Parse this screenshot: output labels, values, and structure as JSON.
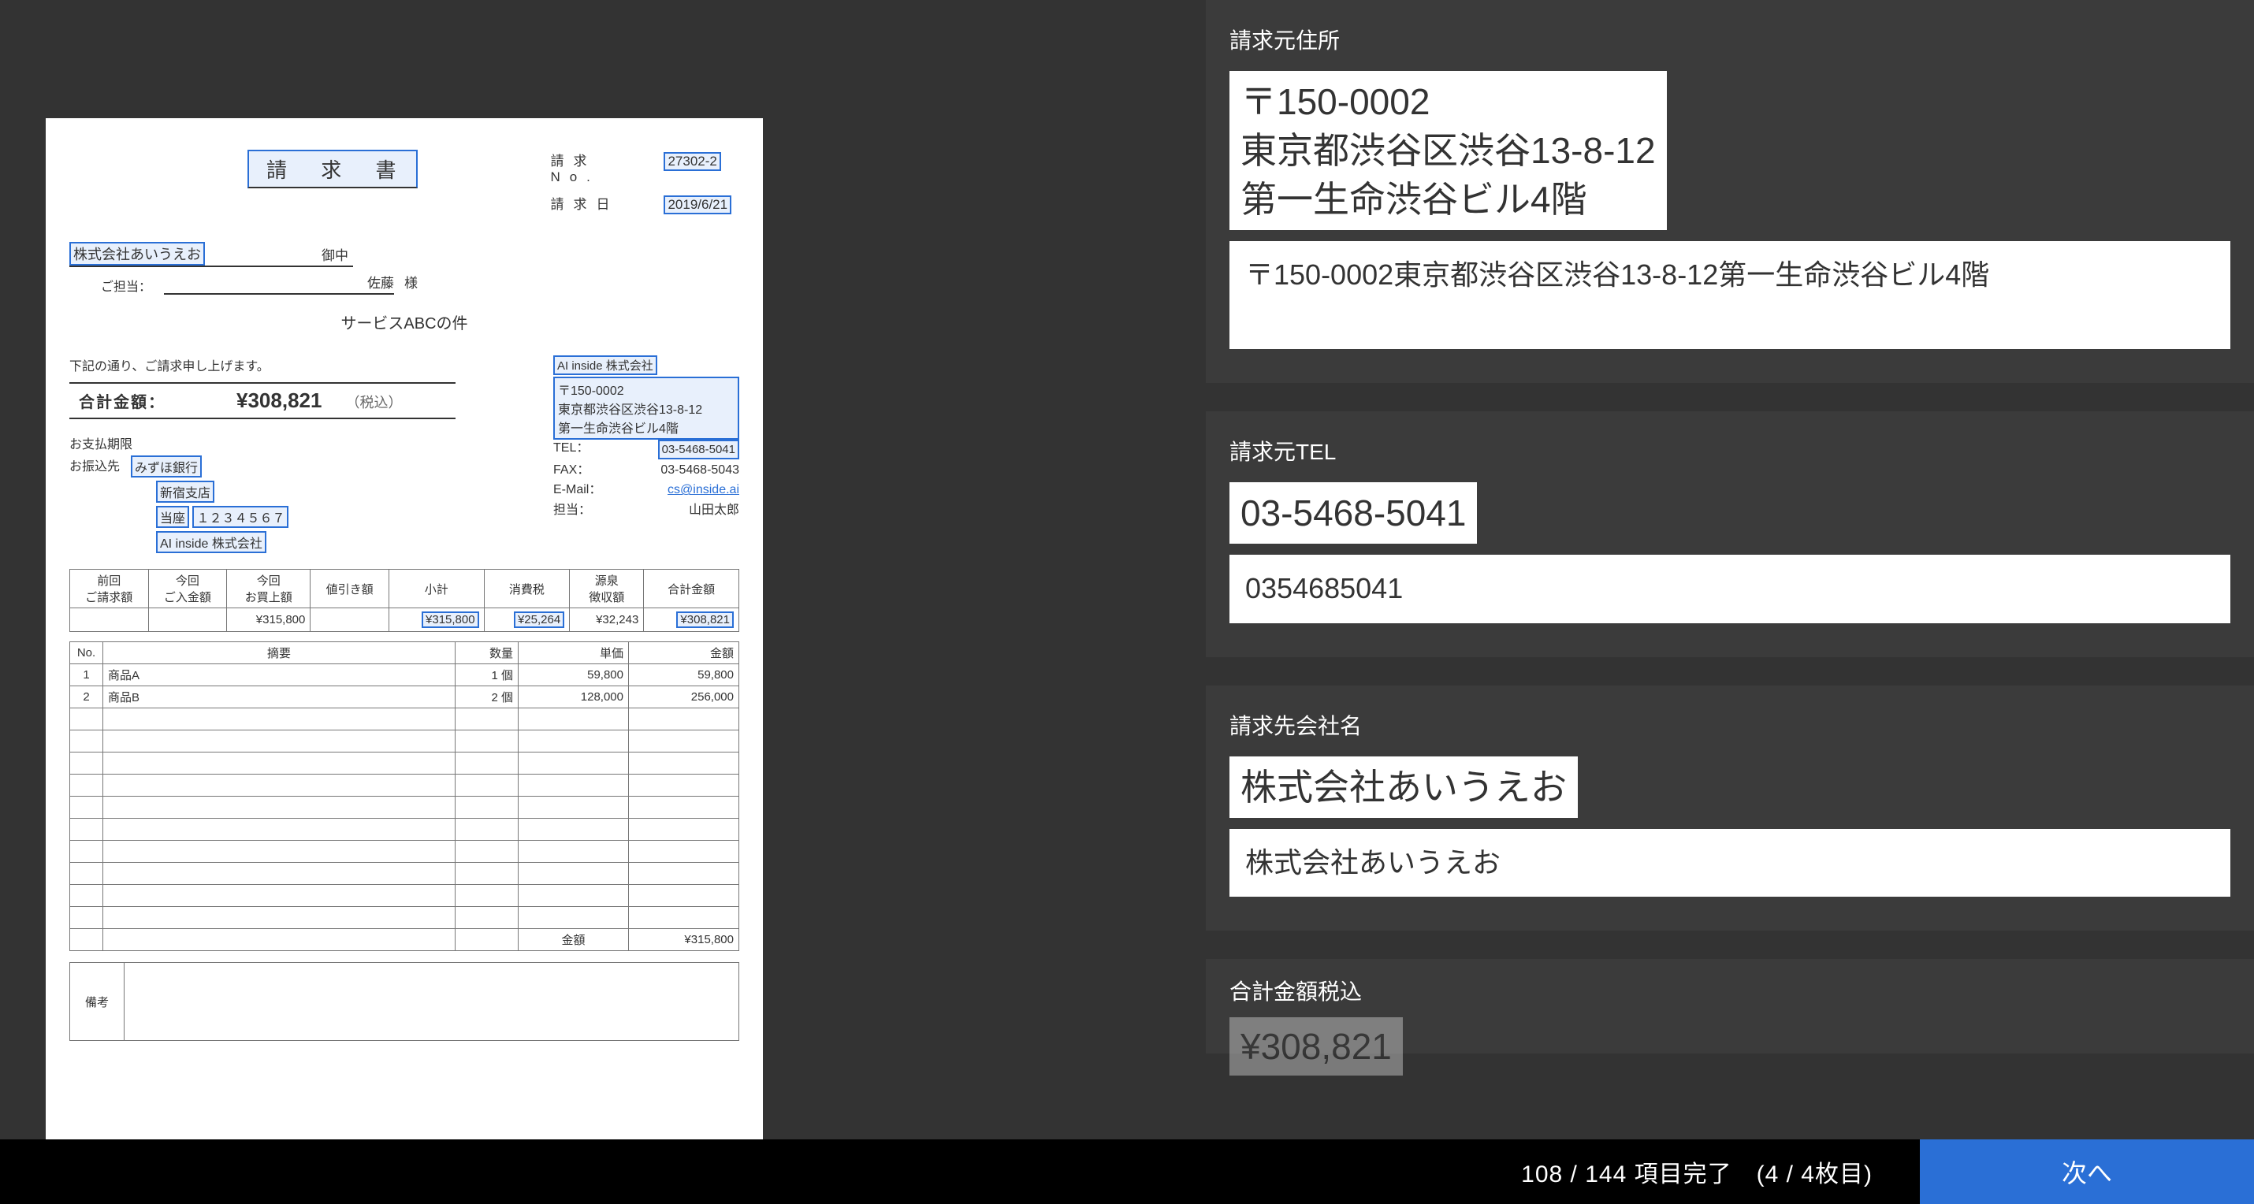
{
  "document": {
    "title": "請 求 書",
    "invoice_no_label": "請求No.",
    "invoice_no": "27302-2",
    "invoice_date_label": "請求日",
    "invoice_date": "2019/6/21",
    "recipient_company": "株式会社あいうえお",
    "onchu": "御中",
    "contact_label": "ご担当：",
    "contact_name": "佐藤",
    "sama": "様",
    "subject": "サービスABCの件",
    "notice": "下記の通り、ご請求申し上げます。",
    "total_label": "合計金額：",
    "total_amount": "¥308,821",
    "total_tax": "（税込）",
    "pay_due_label": "お支払期限",
    "bank_label": "お振込先",
    "bank": "みずほ銀行",
    "branch": "新宿支店",
    "account_type": "当座",
    "account_no": "１２３４５６７",
    "account_holder": "AI inside 株式会社",
    "issuer_company": "AI inside 株式会社",
    "issuer_postal": "〒150-0002",
    "issuer_addr1": "東京都渋谷区渋谷13-8-12",
    "issuer_addr2": "第一生命渋谷ビル4階",
    "issuer_tel_label": "TEL：",
    "issuer_tel": "03-5468-5041",
    "issuer_fax_label": "FAX：",
    "issuer_fax": "03-5468-5043",
    "issuer_email_label": "E-Mail：",
    "issuer_email": "cs@inside.ai",
    "issuer_contact_label": "担当：",
    "issuer_contact": "山田太郎",
    "summary_headers": [
      "前回\nご請求額",
      "今回\nご入金額",
      "今回\nお買上額",
      "値引き額",
      "小計",
      "消費税",
      "源泉\n徴収額",
      "合計金額"
    ],
    "summary_values": [
      "",
      "",
      "¥315,800",
      "",
      "¥315,800",
      "¥25,264",
      "¥32,243",
      "¥308,821"
    ],
    "summary_highlights": [
      false,
      false,
      false,
      false,
      true,
      true,
      false,
      true
    ],
    "items_headers": {
      "no": "No.",
      "desc": "摘要",
      "qty": "数量",
      "price": "単価",
      "amt": "金額"
    },
    "items": [
      {
        "no": "1",
        "desc": "商品A",
        "qty": "1 個",
        "price": "59,800",
        "amt": "59,800"
      },
      {
        "no": "2",
        "desc": "商品B",
        "qty": "2 個",
        "price": "128,000",
        "amt": "256,000"
      }
    ],
    "items_total_label": "金額",
    "items_total_value": "¥315,800",
    "remarks_label": "備考"
  },
  "form": {
    "fields": [
      {
        "label": "請求元住所",
        "snippet": "〒150-0002\n東京都渋谷区渋谷13-8-12\n第一生命渋谷ビル4階",
        "value": "〒150-0002東京都渋谷区渋谷13-8-12第一生命渋谷ビル4階",
        "multiline": true
      },
      {
        "label": "請求元TEL",
        "snippet": "03-5468-5041",
        "value": "0354685041",
        "multiline": false
      },
      {
        "label": "請求先会社名",
        "snippet": "株式会社あいうえお",
        "value": "株式会社あいうえお",
        "multiline": false
      }
    ],
    "peek": {
      "label": "合計金額税込",
      "snippet": "¥308,821"
    }
  },
  "footer": {
    "progress": "108 / 144 項目完了　(4 / 4枚目)",
    "next": "次へ"
  }
}
